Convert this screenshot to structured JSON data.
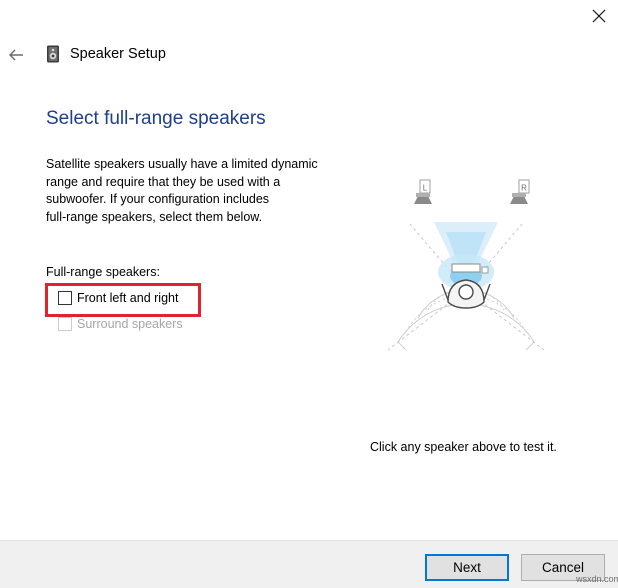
{
  "window": {
    "title": "Speaker Setup",
    "close_icon": "close-icon",
    "back_icon": "back-arrow-icon"
  },
  "page": {
    "heading": "Select full-range speakers",
    "description": "Satellite speakers usually have a limited dynamic\nrange and require that they be used with a\nsubwoofer.  If your configuration includes\nfull-range speakers, select them below.",
    "group_label": "Full-range speakers:",
    "options": [
      {
        "label": "Front left and right",
        "checked": false,
        "enabled": true,
        "highlighted": true
      },
      {
        "label": "Surround speakers",
        "checked": false,
        "enabled": false
      }
    ],
    "diagram": {
      "left_speaker_label": "L",
      "right_speaker_label": "R"
    },
    "test_hint": "Click any speaker above to test it."
  },
  "footer": {
    "next_label": "Next",
    "cancel_label": "Cancel"
  },
  "colors": {
    "heading": "#1e3f8a",
    "highlight_box": "#e0242f",
    "default_button_border": "#0078d7",
    "disabled_text": "#a6a6a6",
    "footer_bg": "#f0f0f0"
  },
  "watermark": "wsxdn.com"
}
